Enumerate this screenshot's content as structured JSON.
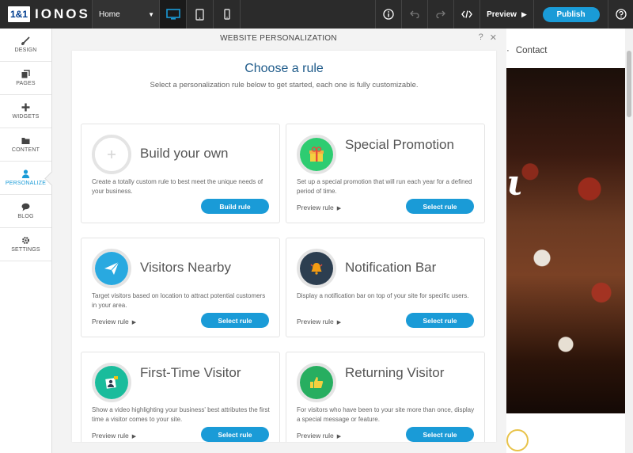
{
  "app": {
    "logo_box": "1&1",
    "logo_text": "IONOS"
  },
  "toolbar": {
    "page_select": "Home",
    "preview_label": "Preview",
    "publish_label": "Publish"
  },
  "sidebar": {
    "items": [
      {
        "label": "DESIGN",
        "icon": "brush-icon",
        "active": false
      },
      {
        "label": "PAGES",
        "icon": "pages-icon",
        "active": false
      },
      {
        "label": "WIDGETS",
        "icon": "plus-icon",
        "active": false
      },
      {
        "label": "CONTENT",
        "icon": "folder-icon",
        "active": false
      },
      {
        "label": "PERSONALIZE",
        "icon": "user-icon",
        "active": true
      },
      {
        "label": "BLOG",
        "icon": "chat-icon",
        "active": false
      },
      {
        "label": "SETTINGS",
        "icon": "gear-icon",
        "active": false
      }
    ]
  },
  "modal": {
    "title": "WEBSITE PERSONALIZATION",
    "help": "?",
    "close": "✕",
    "heading": "Choose a rule",
    "subheading": "Select a personalization rule below to get started, each one is fully customizable.",
    "cards": [
      {
        "title": "Build your own",
        "description": "Create a totally custom rule to best meet the unique needs of your business.",
        "preview": "",
        "button": "Build rule",
        "icon": "plus-icon"
      },
      {
        "title": "Special Promotion",
        "description": "Set up a special promotion that will run each year for a defined period of time.",
        "preview": "Preview rule",
        "button": "Select rule",
        "icon": "gift-icon"
      },
      {
        "title": "Visitors Nearby",
        "description": "Target visitors based on location to attract potential customers in your area.",
        "preview": "Preview rule",
        "button": "Select rule",
        "icon": "paper-plane-icon"
      },
      {
        "title": "Notification Bar",
        "description": "Display a notification bar on top of your site for specific users.",
        "preview": "Preview rule",
        "button": "Select rule",
        "icon": "bell-icon"
      },
      {
        "title": "First-Time Visitor",
        "description": "Show a video highlighting your business' best attributes the first time a visitor comes to your site.",
        "preview": "Preview rule",
        "button": "Select rule",
        "icon": "video-user-icon"
      },
      {
        "title": "Returning Visitor",
        "description": "For visitors who have been to your site more than once, display a special message or feature.",
        "preview": "Preview rule",
        "button": "Select rule",
        "icon": "thumbs-up-icon"
      }
    ]
  },
  "site": {
    "nav_contact": "Contact"
  },
  "colors": {
    "accent": "#1a9bd7",
    "topbar": "#2b2b2b",
    "heading": "#1f5b8a"
  }
}
